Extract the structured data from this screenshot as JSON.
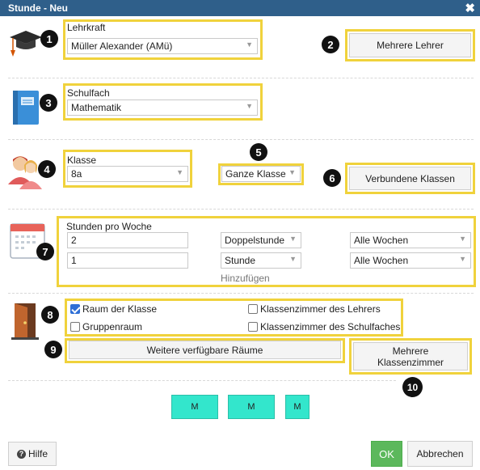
{
  "window": {
    "title": "Stunde - Neu",
    "close_glyph": "✖"
  },
  "badges": [
    "1",
    "2",
    "3",
    "4",
    "5",
    "6",
    "7",
    "8",
    "9",
    "10"
  ],
  "teacher": {
    "label": "Lehrkraft",
    "value": "Müller Alexander (AMü)",
    "multi_button": "Mehrere Lehrer"
  },
  "subject": {
    "label": "Schulfach",
    "value": "Mathematik"
  },
  "class": {
    "label": "Klasse",
    "value": "8a",
    "scope_value": "Ganze Klasse",
    "linked_button": "Verbundene Klassen"
  },
  "hours": {
    "label": "Stunden pro Woche",
    "rows": [
      {
        "count": "2",
        "type": "Doppelstunde",
        "weeks": "Alle Wochen"
      },
      {
        "count": "1",
        "type": "Stunde",
        "weeks": "Alle Wochen"
      }
    ],
    "add_label": "Hinzufügen"
  },
  "rooms": {
    "options": [
      {
        "label": "Raum der Klasse",
        "checked": true
      },
      {
        "label": "Klassenzimmer des Lehrers",
        "checked": false
      },
      {
        "label": "Gruppenraum",
        "checked": false
      },
      {
        "label": "Klassenzimmer des Schulfaches",
        "checked": false
      }
    ],
    "more_rooms_button": "Weitere verfügbare Räume",
    "multi_classrooms_button": "Mehrere Klassenzimmer"
  },
  "markers": [
    "M",
    "M",
    "M"
  ],
  "footer": {
    "help": "Hilfe",
    "help_icon": "?",
    "ok": "OK",
    "cancel": "Abbrechen"
  },
  "colors": {
    "titlebar": "#2f5f8a",
    "highlight": "#f0d23c",
    "marker": "#33e6cc",
    "ok": "#5cb85c"
  }
}
